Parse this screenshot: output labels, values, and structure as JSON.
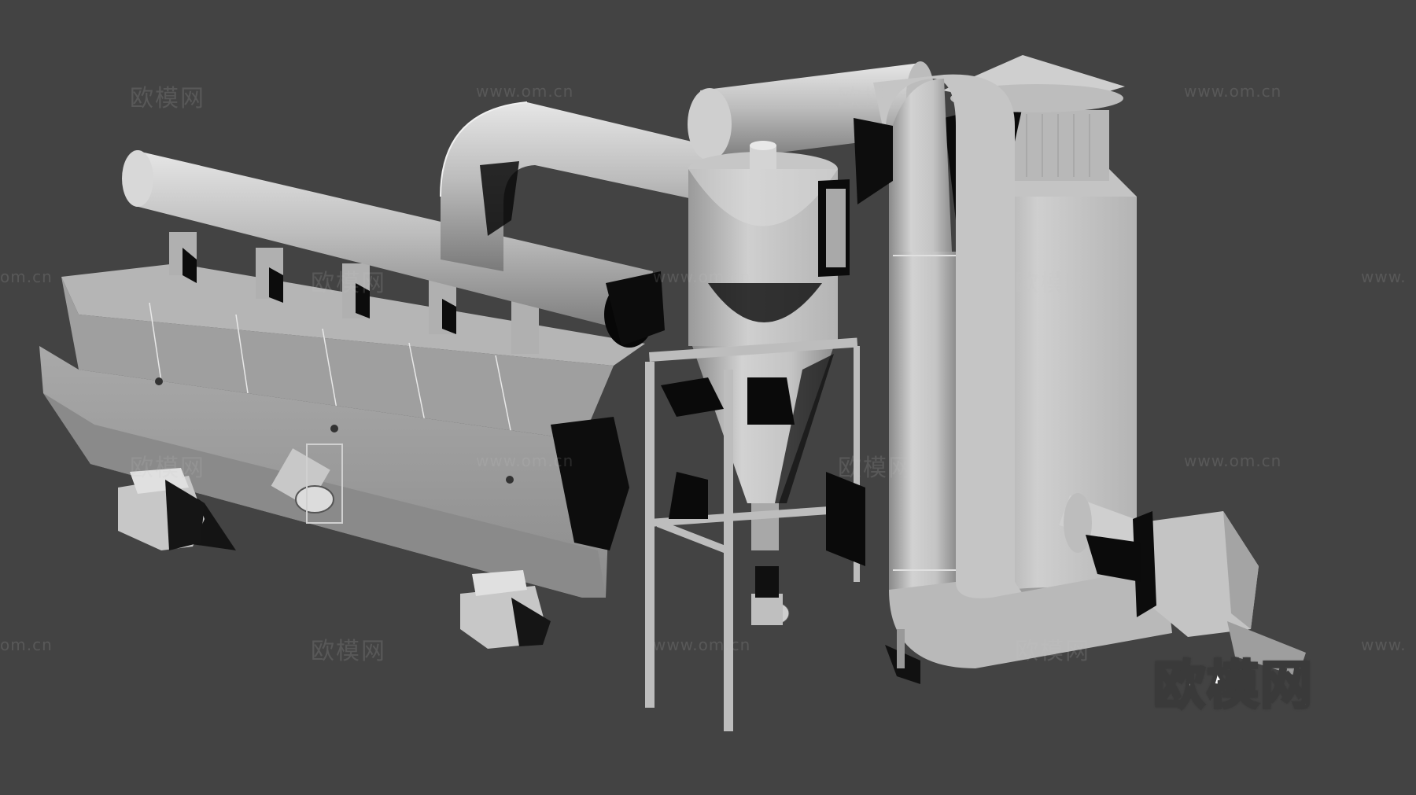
{
  "watermarks": {
    "cn_text": "欧模网",
    "url_text": "www.om.cn",
    "url_partial": "om.cn",
    "url_prefix": "www."
  },
  "logo_text": "欧模网",
  "colors": {
    "background": "#434343",
    "model_light": "#cfcfcf",
    "model_mid": "#a8a8a8",
    "model_dark": "#6e6e6e",
    "shadow": "#0a0a0a"
  }
}
